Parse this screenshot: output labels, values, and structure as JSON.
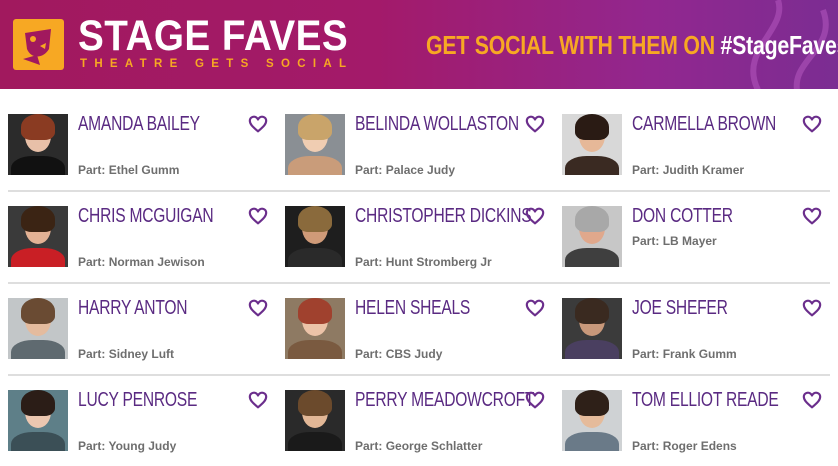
{
  "header": {
    "brand_title": "STAGE FAVES",
    "brand_subtitle": "THEATRE GETS SOCIAL",
    "cta_text": "GET SOCIAL WITH THEM ON ",
    "cta_hashtag": "#StageFaves",
    "colors": {
      "gradient_start": "#a1195e",
      "gradient_end": "#7b2d92",
      "accent": "#f7a823"
    }
  },
  "part_prefix": "Part: ",
  "colors": {
    "name": "#5a2a82",
    "heart": "#6b2e8c",
    "part": "#6e6e6e",
    "divider": "#dedede"
  },
  "cast": [
    {
      "name": "AMANDA BAILEY",
      "part": "Ethel Gumm",
      "part_line": 2,
      "photo_bg": "#2b2b2b",
      "skin": "#e8c0a8",
      "hair": "#8a3b22",
      "top": "#111111"
    },
    {
      "name": "BELINDA WOLLASTON",
      "part": "Palace Judy",
      "part_line": 2,
      "photo_bg": "#8a8f94",
      "skin": "#f0cdb2",
      "hair": "#c9a46a",
      "top": "#c99c7a"
    },
    {
      "name": "CARMELLA BROWN",
      "part": "Judith Kramer",
      "part_line": 2,
      "photo_bg": "#d8d8d8",
      "skin": "#e6b898",
      "hair": "#2a1b14",
      "top": "#3a2a22"
    },
    {
      "name": "CHRIS MCGUIGAN",
      "part": "Norman Jewison",
      "part_line": 2,
      "photo_bg": "#3a3a3a",
      "skin": "#e3b295",
      "hair": "#3b2414",
      "top": "#c91f25"
    },
    {
      "name": "CHRISTOPHER DICKINS",
      "part": "Hunt Stromberg Jr",
      "part_line": 2,
      "photo_bg": "#1e1e1e",
      "skin": "#cf9a78",
      "hair": "#8a6a3c",
      "top": "#2a2a2a"
    },
    {
      "name": "DON COTTER",
      "part": "LB Mayer",
      "part_line": 1,
      "photo_bg": "#c7c7c7",
      "skin": "#e0a88c",
      "hair": "#a8a8a8",
      "top": "#3f3f3f"
    },
    {
      "name": "HARRY ANTON",
      "part": "Sidney Luft",
      "part_line": 2,
      "photo_bg": "#c2c6c8",
      "skin": "#e4bb9e",
      "hair": "#6a4b33",
      "top": "#5f6a70"
    },
    {
      "name": "HELEN SHEALS",
      "part": "CBS Judy",
      "part_line": 2,
      "photo_bg": "#8e7a63",
      "skin": "#ecc3a8",
      "hair": "#a0412e",
      "top": "#7a5a40"
    },
    {
      "name": "JOE SHEFER",
      "part": "Frank Gumm",
      "part_line": 2,
      "photo_bg": "#3b3b3b",
      "skin": "#c8987a",
      "hair": "#3a2a20",
      "top": "#4a3f60"
    },
    {
      "name": "LUCY PENROSE",
      "part": "Young Judy",
      "part_line": 2,
      "photo_bg": "#5e7f88",
      "skin": "#ecc7b0",
      "hair": "#2b1d17",
      "top": "#3b4f56"
    },
    {
      "name": "PERRY MEADOWCROFT",
      "part": "George Schlatter",
      "part_line": 2,
      "photo_bg": "#2a2a2a",
      "skin": "#e2b796",
      "hair": "#6b4a2c",
      "top": "#1a1a1a"
    },
    {
      "name": "TOM ELLIOT READE",
      "part": "Roger Edens",
      "part_line": 2,
      "photo_bg": "#cfd2d4",
      "skin": "#e5bb9b",
      "hair": "#2e2018",
      "top": "#6a7a88"
    }
  ]
}
